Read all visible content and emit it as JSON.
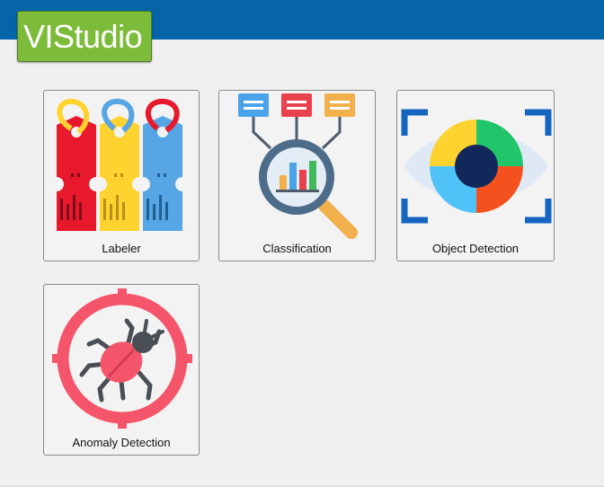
{
  "app": {
    "logo_text": "VIStudio",
    "header_color": "#0565a8",
    "logo_color": "#7dbb3b"
  },
  "tiles": [
    {
      "label": "Labeler",
      "icon": "price-tags-icon"
    },
    {
      "label": "Classification",
      "icon": "magnifier-chart-icon"
    },
    {
      "label": "Object Detection",
      "icon": "eye-scan-icon"
    },
    {
      "label": "Anomaly Detection",
      "icon": "bug-target-icon"
    }
  ]
}
